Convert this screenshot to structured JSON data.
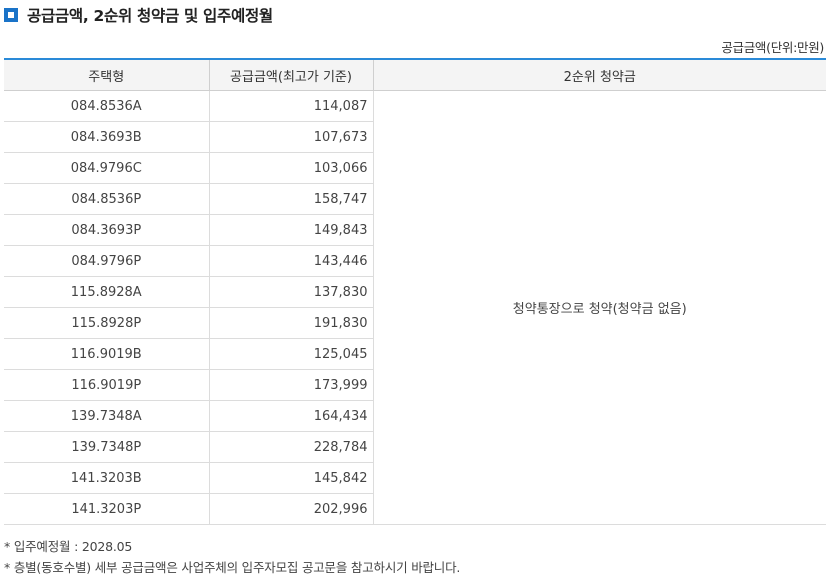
{
  "heading": {
    "icon": "square-bullet-icon",
    "title": "공급금액, 2순위 청약금 및 입주예정월"
  },
  "unit_label": "공급금액(단위:만원)",
  "table": {
    "columns": [
      "주택형",
      "공급금액(최고가 기준)",
      "2순위 청약금"
    ],
    "rows": [
      {
        "type": "084.8536A",
        "amount": "114,087"
      },
      {
        "type": "084.3693B",
        "amount": "107,673"
      },
      {
        "type": "084.9796C",
        "amount": "103,066"
      },
      {
        "type": "084.8536P",
        "amount": "158,747"
      },
      {
        "type": "084.3693P",
        "amount": "149,843"
      },
      {
        "type": "084.9796P",
        "amount": "143,446"
      },
      {
        "type": "115.8928A",
        "amount": "137,830"
      },
      {
        "type": "115.8928P",
        "amount": "191,830"
      },
      {
        "type": "116.9019B",
        "amount": "125,045"
      },
      {
        "type": "116.9019P",
        "amount": "173,999"
      },
      {
        "type": "139.7348A",
        "amount": "164,434"
      },
      {
        "type": "139.7348P",
        "amount": "228,784"
      },
      {
        "type": "141.3203B",
        "amount": "145,842"
      },
      {
        "type": "141.3203P",
        "amount": "202,996"
      }
    ],
    "second_rank_deposit": "청약통장으로 청약(청약금 없음)"
  },
  "notes": [
    "* 입주예정월 : 2028.05",
    "* 층별(동호수별) 세부 공급금액은 사업주체의 입주자모집 공고문을 참고하시기 바랍니다."
  ],
  "colors": {
    "accent": "#1a73c8",
    "table_top_border": "#2a8ad8",
    "header_bg": "#f4f4f4"
  }
}
